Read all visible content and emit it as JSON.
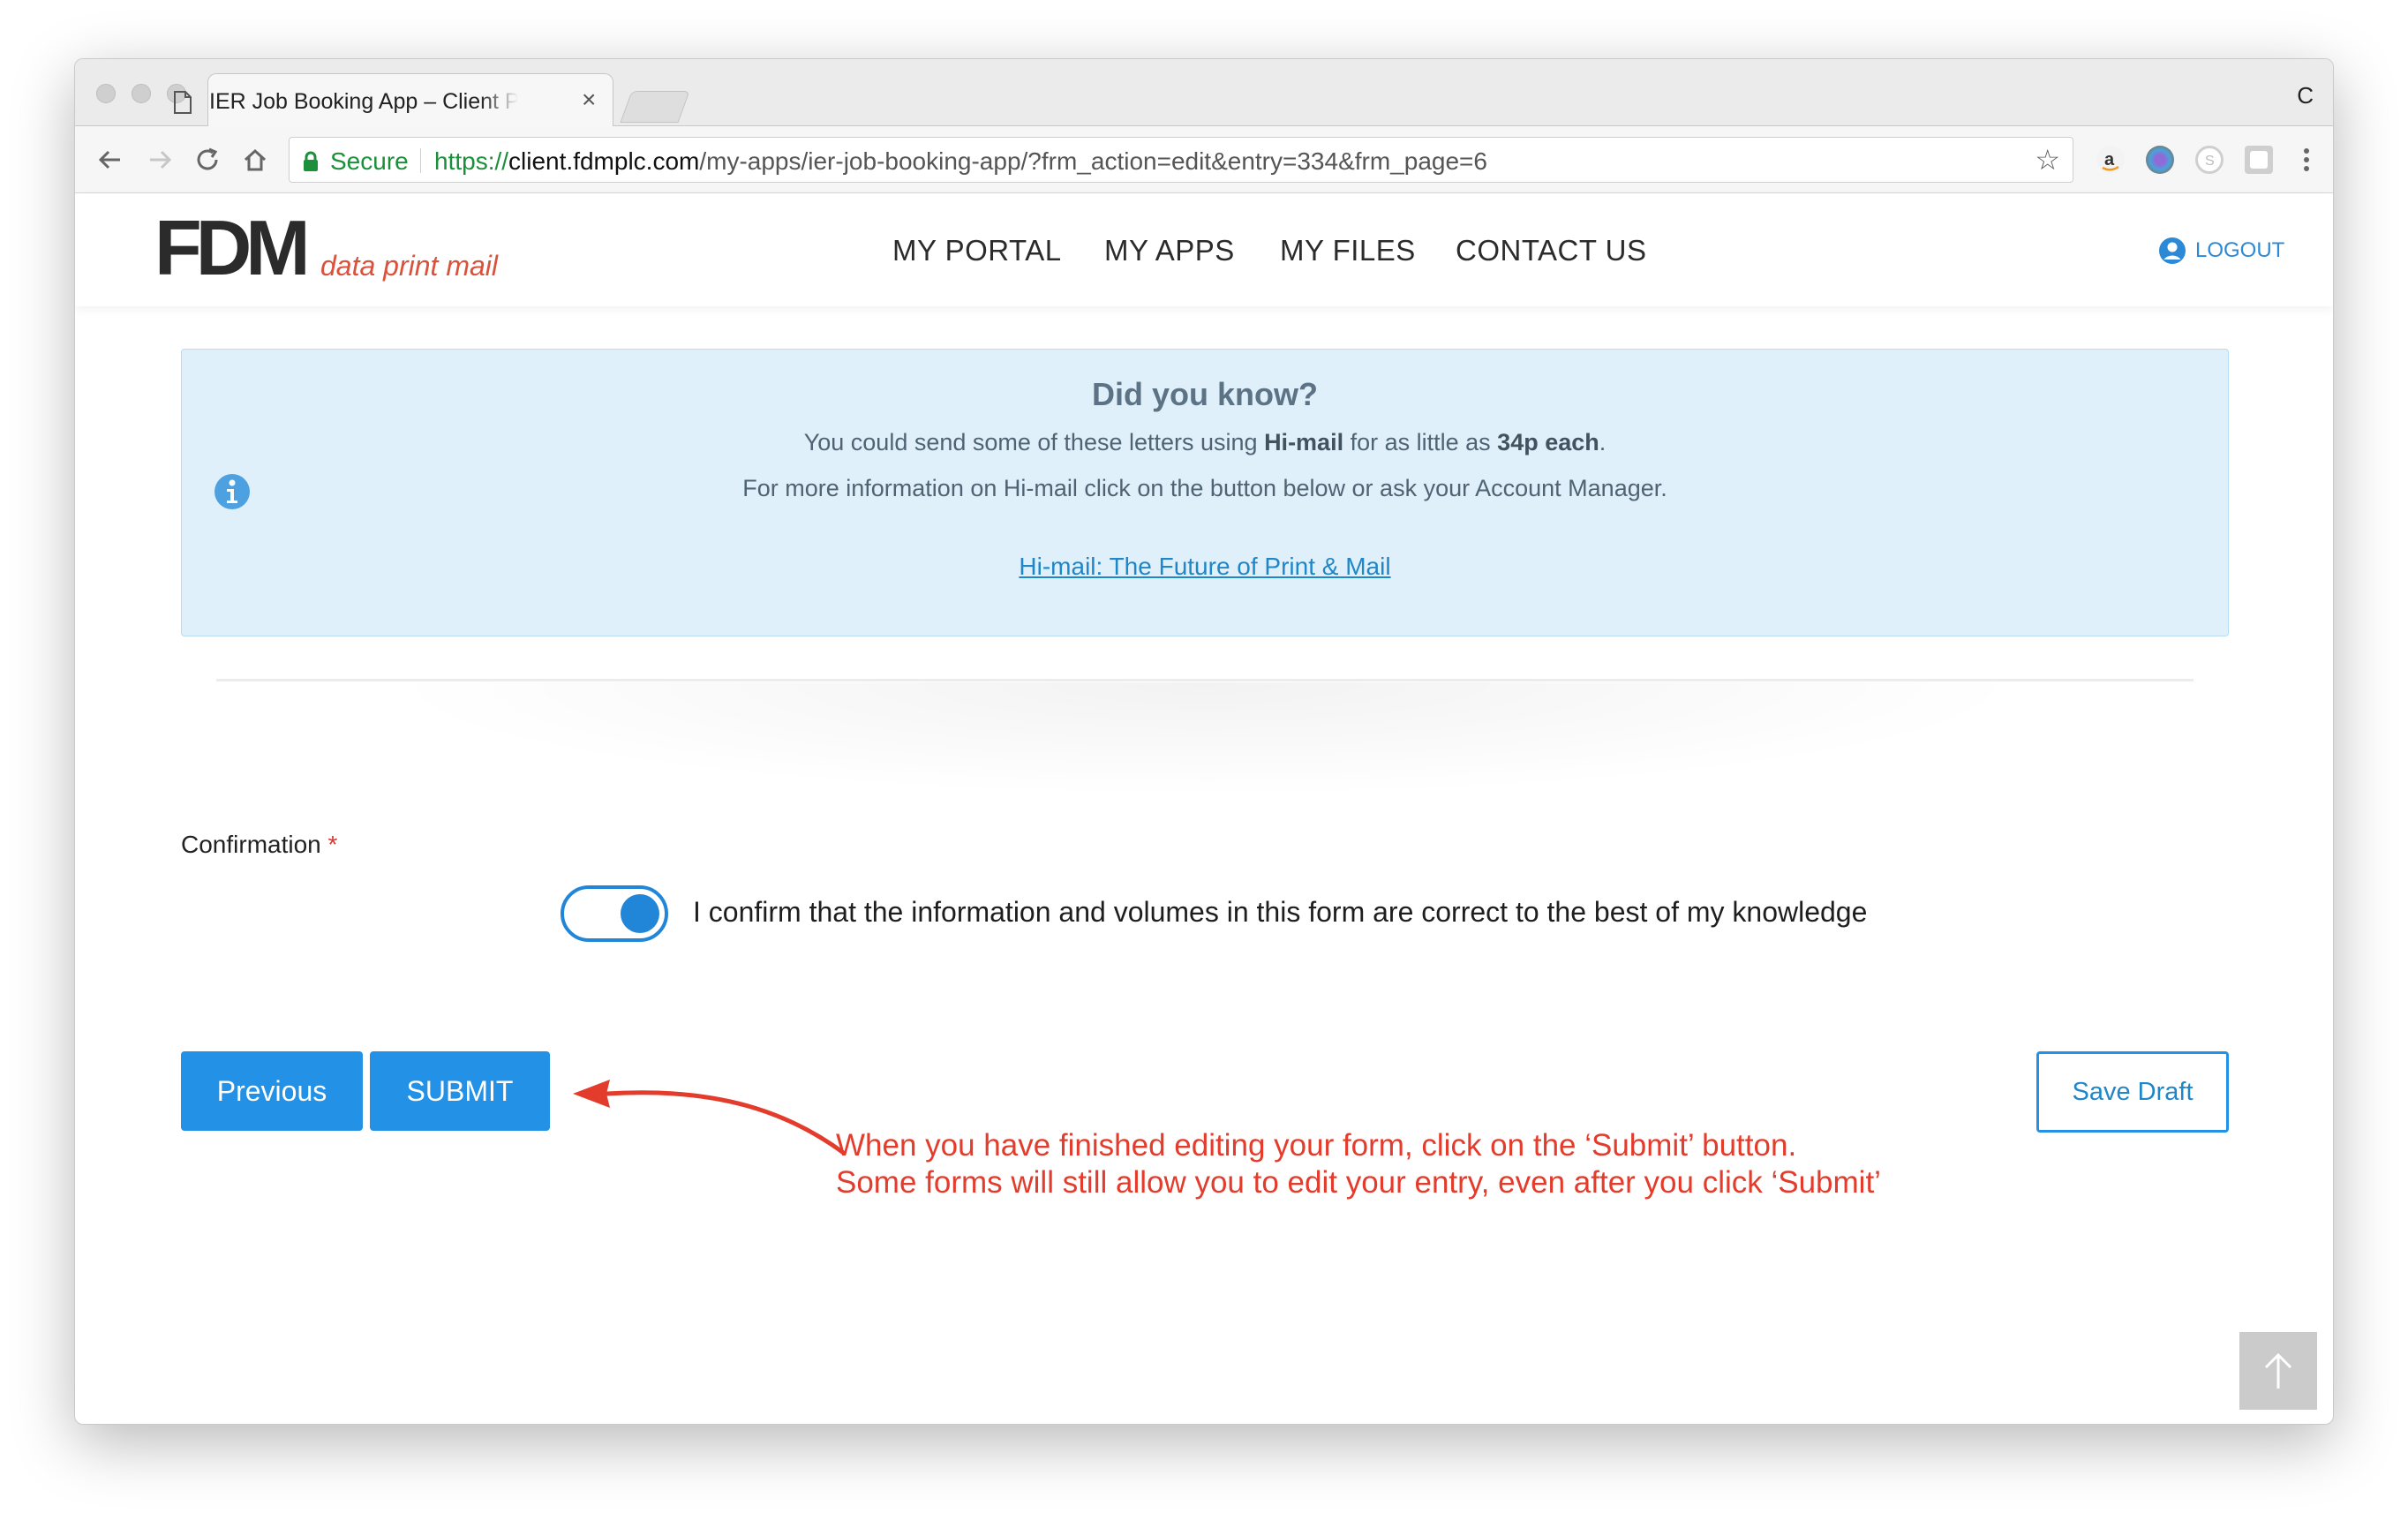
{
  "browser": {
    "tab_title": "IER Job Booking App – Client Portal",
    "tab_close": "×",
    "profile_initial": "C",
    "secure_label": "Secure",
    "url_scheme": "https://",
    "url_host": "client.fdmplc.com",
    "url_path": "/my-apps/ier-job-booking-app/?frm_action=edit&entry=334&frm_page=6",
    "star": "☆",
    "extensions": [
      "amazon-extension-icon",
      "color-extension-icon",
      "skype-extension-icon",
      "window-extension-icon"
    ]
  },
  "header": {
    "logo_mark": "FDM",
    "logo_tagline": "data print mail",
    "nav": [
      "MY PORTAL",
      "MY APPS",
      "MY FILES",
      "CONTACT US"
    ],
    "logout": "LOGOUT"
  },
  "info": {
    "title": "Did you know?",
    "line1_pre": "You could send some of these letters using ",
    "line1_bold1": "Hi-mail",
    "line1_mid": " for as little as ",
    "line1_bold2": "34p each",
    "line1_post": ".",
    "line2": "For more information on Hi-mail click on the button below or ask your Account Manager.",
    "link": "Hi-mail: The Future of Print & Mail"
  },
  "form": {
    "confirmation_label": "Confirmation",
    "required_mark": "*",
    "toggle_on": true,
    "confirm_text": "I confirm that the information and volumes in this form are correct to the best of my knowledge",
    "previous": "Previous",
    "submit": "SUBMIT",
    "save_draft": "Save Draft"
  },
  "annotation": {
    "line1": "When you have finished editing your form, click on the ‘Submit’ button.",
    "line2": "Some forms will still allow you to edit your entry, even after you click ‘Submit’"
  },
  "colors": {
    "accent": "#2392e6",
    "secure_green": "#1b8f3a",
    "annotation_red": "#e43c2c",
    "logo_red": "#d9523b",
    "info_bg": "#dff0fb"
  }
}
